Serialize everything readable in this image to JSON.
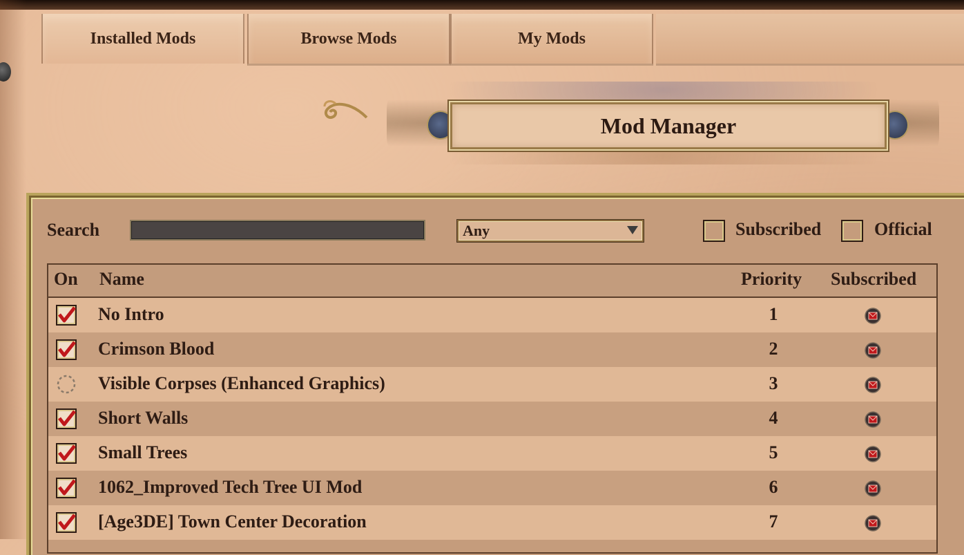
{
  "tabs": [
    {
      "label": "Installed Mods",
      "active": true
    },
    {
      "label": "Browse Mods",
      "active": false
    },
    {
      "label": "My Mods",
      "active": false
    }
  ],
  "title": "Mod Manager",
  "search": {
    "label": "Search",
    "value": "",
    "dropdown_value": "Any"
  },
  "filters": {
    "subscribed_label": "Subscribed",
    "subscribed_checked": false,
    "official_label": "Official",
    "official_checked": false
  },
  "table": {
    "headers": {
      "on": "On",
      "name": "Name",
      "priority": "Priority",
      "subscribed": "Subscribed"
    },
    "rows": [
      {
        "on": "checked",
        "name": "No Intro",
        "priority": "1",
        "subscribed": true
      },
      {
        "on": "checked",
        "name": "Crimson Blood",
        "priority": "2",
        "subscribed": true
      },
      {
        "on": "loading",
        "name": "Visible Corpses (Enhanced Graphics)",
        "priority": "3",
        "subscribed": true
      },
      {
        "on": "checked",
        "name": "Short Walls",
        "priority": "4",
        "subscribed": true
      },
      {
        "on": "checked",
        "name": "Small Trees",
        "priority": "5",
        "subscribed": true
      },
      {
        "on": "checked",
        "name": "1062_Improved Tech Tree UI Mod",
        "priority": "6",
        "subscribed": true
      },
      {
        "on": "checked",
        "name": "[Age3DE] Town Center Decoration",
        "priority": "7",
        "subscribed": true
      }
    ]
  },
  "colors": {
    "parchment": "#e3b795",
    "panel": "#c59c7c",
    "row_light": "#e0b896",
    "row_dark": "#c8a080",
    "check_red": "#c0181c",
    "text": "#2e1c14"
  }
}
